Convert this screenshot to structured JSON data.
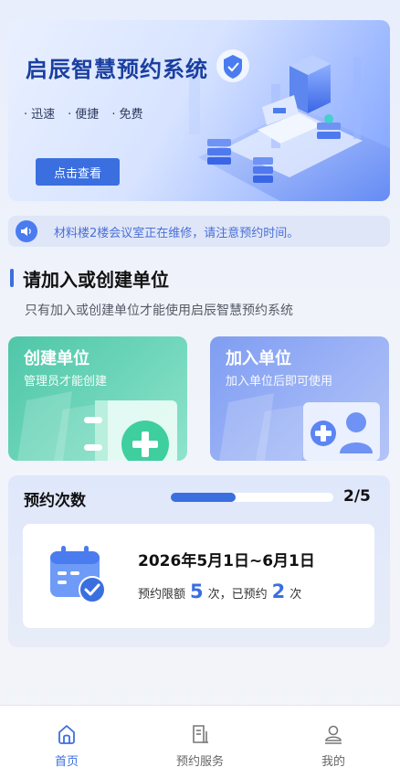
{
  "banner": {
    "title": "启辰智慧预约系统",
    "tags": [
      "迅速",
      "便捷",
      "免费"
    ],
    "button_label": "点击查看"
  },
  "notice": {
    "icon": "speaker-icon",
    "text": "材料楼2楼会议室正在维修，请注意预约时间。"
  },
  "section": {
    "title": "请加入或创建单位",
    "subtitle": "只有加入或创建单位才能使用启辰智慧预约系统"
  },
  "cards": {
    "create": {
      "title": "创建单位",
      "subtitle": "管理员才能创建",
      "icon": "add-document-icon"
    },
    "join": {
      "title": "加入单位",
      "subtitle": "加入单位后即可使用",
      "icon": "add-user-icon"
    }
  },
  "reservation": {
    "title": "预约次数",
    "progress_text": "2/5",
    "progress_used": 2,
    "progress_total": 5,
    "date_range": "2026年5月1日~6月1日",
    "limit_label": "预约限额",
    "limit_value": "5",
    "limit_unit": "次，",
    "booked_label": "已预约",
    "booked_value": "2",
    "booked_unit": "次"
  },
  "nav": {
    "items": [
      {
        "label": "首页",
        "icon": "home-icon",
        "active": true
      },
      {
        "label": "预约服务",
        "icon": "reservation-icon",
        "active": false
      },
      {
        "label": "我的",
        "icon": "profile-icon",
        "active": false
      }
    ]
  },
  "colors": {
    "accent": "#3b6fe0",
    "create_card": "#4fc6a8",
    "join_card": "#7f9df2"
  }
}
